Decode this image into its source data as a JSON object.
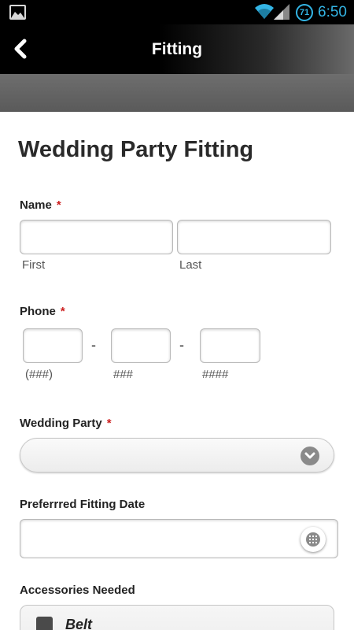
{
  "status_bar": {
    "time": "6:50",
    "notification_badge": "71",
    "icons": [
      "picture-icon",
      "wifi-icon",
      "signal-icon",
      "notification-badge-icon"
    ],
    "accent_color": "#33b5e5"
  },
  "action_bar": {
    "title": "Fitting",
    "back_icon": "chevron-left-icon"
  },
  "form": {
    "title": "Wedding Party Fitting",
    "required_marker": "*",
    "name": {
      "label": "Name",
      "first_value": "",
      "last_value": "",
      "first_sublabel": "First",
      "last_sublabel": "Last"
    },
    "phone": {
      "label": "Phone",
      "separator": "-",
      "area_value": "",
      "prefix_value": "",
      "line_value": "",
      "area_hint": "(###)",
      "prefix_hint": "###",
      "line_hint": "####"
    },
    "wedding_party": {
      "label": "Wedding Party",
      "selected": ""
    },
    "fitting_date": {
      "label": "Preferrred Fitting Date",
      "value": ""
    },
    "accessories": {
      "label": "Accessories Needed",
      "options": [
        {
          "label": "Belt",
          "checked": false
        }
      ]
    }
  }
}
